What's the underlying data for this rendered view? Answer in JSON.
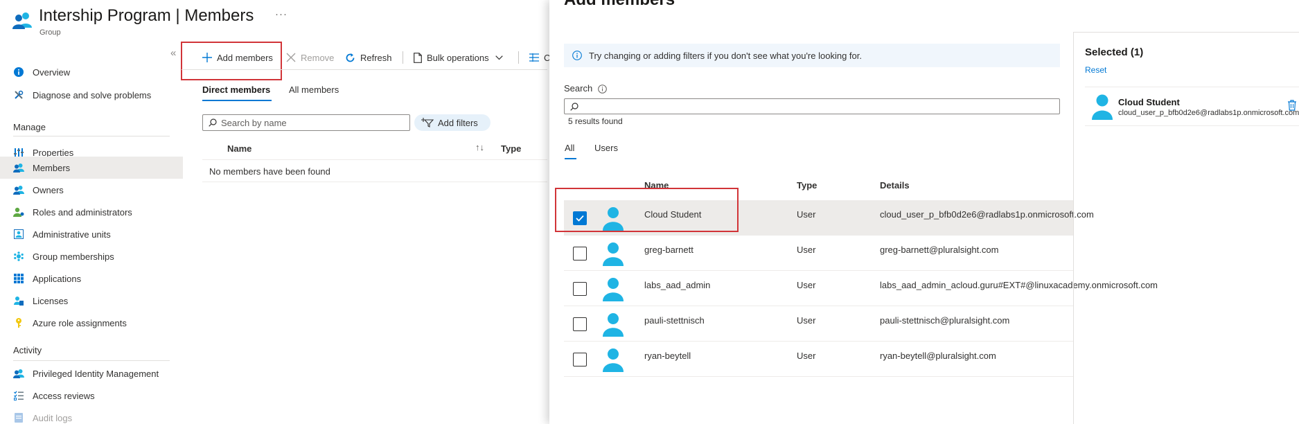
{
  "header": {
    "title_main": "Intership Program",
    "title_separator": " | ",
    "title_page": "Members",
    "subtitle": "Group",
    "more": "···"
  },
  "nav": {
    "collapse": "«",
    "items_top": [
      {
        "label": "Overview",
        "icon": "info-icon"
      },
      {
        "label": "Diagnose and solve problems",
        "icon": "wrench-icon"
      }
    ],
    "manage_heading": "Manage",
    "manage_items": [
      {
        "label": "Properties",
        "icon": "properties-icon"
      },
      {
        "label": "Members",
        "icon": "members-icon",
        "active": true
      },
      {
        "label": "Owners",
        "icon": "owners-icon"
      },
      {
        "label": "Roles and administrators",
        "icon": "roles-icon"
      },
      {
        "label": "Administrative units",
        "icon": "admin-units-icon"
      },
      {
        "label": "Group memberships",
        "icon": "group-memberships-icon"
      },
      {
        "label": "Applications",
        "icon": "applications-icon"
      },
      {
        "label": "Licenses",
        "icon": "licenses-icon"
      },
      {
        "label": "Azure role assignments",
        "icon": "key-icon"
      }
    ],
    "activity_heading": "Activity",
    "activity_items": [
      {
        "label": "Privileged Identity Management",
        "icon": "pim-icon"
      },
      {
        "label": "Access reviews",
        "icon": "access-reviews-icon"
      },
      {
        "label": "Audit logs",
        "icon": "audit-logs-icon",
        "disabled": true
      }
    ]
  },
  "toolbar": {
    "add_members": "Add members",
    "remove": "Remove",
    "refresh": "Refresh",
    "bulk_operations": "Bulk operations",
    "columns_partial": "C"
  },
  "left_tabs": {
    "direct": "Direct members",
    "all": "All members"
  },
  "left_search": {
    "placeholder": "Search by name",
    "add_filters": "Add filters"
  },
  "left_table": {
    "col_name": "Name",
    "sort_glyph": "↑↓",
    "col_type": "Type",
    "empty": "No members have been found"
  },
  "blade": {
    "title": "Add members",
    "info": "Try changing or adding filters if you don't see what you're looking for.",
    "search_label": "Search",
    "search_value": "",
    "results": "5 results found",
    "tabs": [
      "All",
      "Users"
    ],
    "columns": {
      "name": "Name",
      "type": "Type",
      "details": "Details"
    },
    "rows": [
      {
        "name": "Cloud Student",
        "type": "User",
        "details": "cloud_user_p_bfb0d2e6@radlabs1p.onmicrosoft.com",
        "checked": true
      },
      {
        "name": "greg-barnett",
        "type": "User",
        "details": "greg-barnett@pluralsight.com",
        "checked": false
      },
      {
        "name": "labs_aad_admin",
        "type": "User",
        "details": "labs_aad_admin_acloud.guru#EXT#@linuxacademy.onmicrosoft.com",
        "checked": false
      },
      {
        "name": "pauli-stettnisch",
        "type": "User",
        "details": "pauli-stettnisch@pluralsight.com",
        "checked": false
      },
      {
        "name": "ryan-beytell",
        "type": "User",
        "details": "ryan-beytell@pluralsight.com",
        "checked": false
      }
    ],
    "selected": {
      "title": "Selected (1)",
      "reset": "Reset",
      "item_name": "Cloud Student",
      "item_email": "cloud_user_p_bfb0d2e6@radlabs1p.onmicrosoft.com"
    }
  },
  "colors": {
    "accent": "#0078d4",
    "highlight": "#d13438",
    "avatar": "#1fb4e4"
  }
}
